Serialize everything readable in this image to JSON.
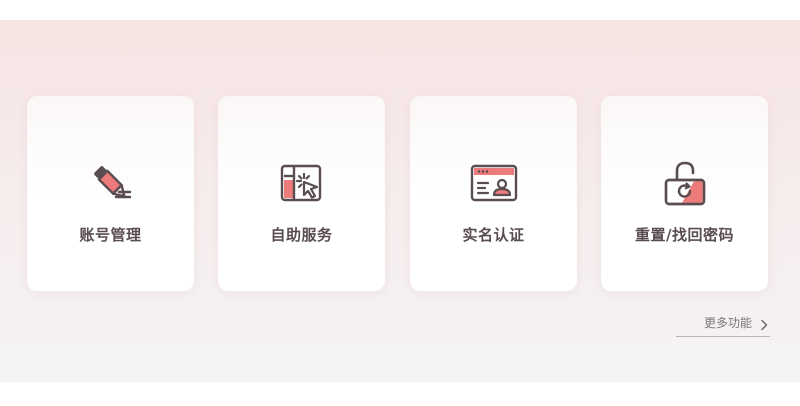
{
  "cards": [
    {
      "label": "账号管理",
      "icon": "pencil-icon"
    },
    {
      "label": "自助服务",
      "icon": "self-service-cursor-icon"
    },
    {
      "label": "实名认证",
      "icon": "id-card-icon"
    },
    {
      "label": "重置/找回密码",
      "icon": "unlock-reset-icon"
    }
  ],
  "more": {
    "label": "更多功能",
    "icon": "chevron-right-icon"
  },
  "colors": {
    "accent": "#ee7b7b",
    "dark": "#5a4d4f",
    "panel": "#f7e4e3"
  }
}
